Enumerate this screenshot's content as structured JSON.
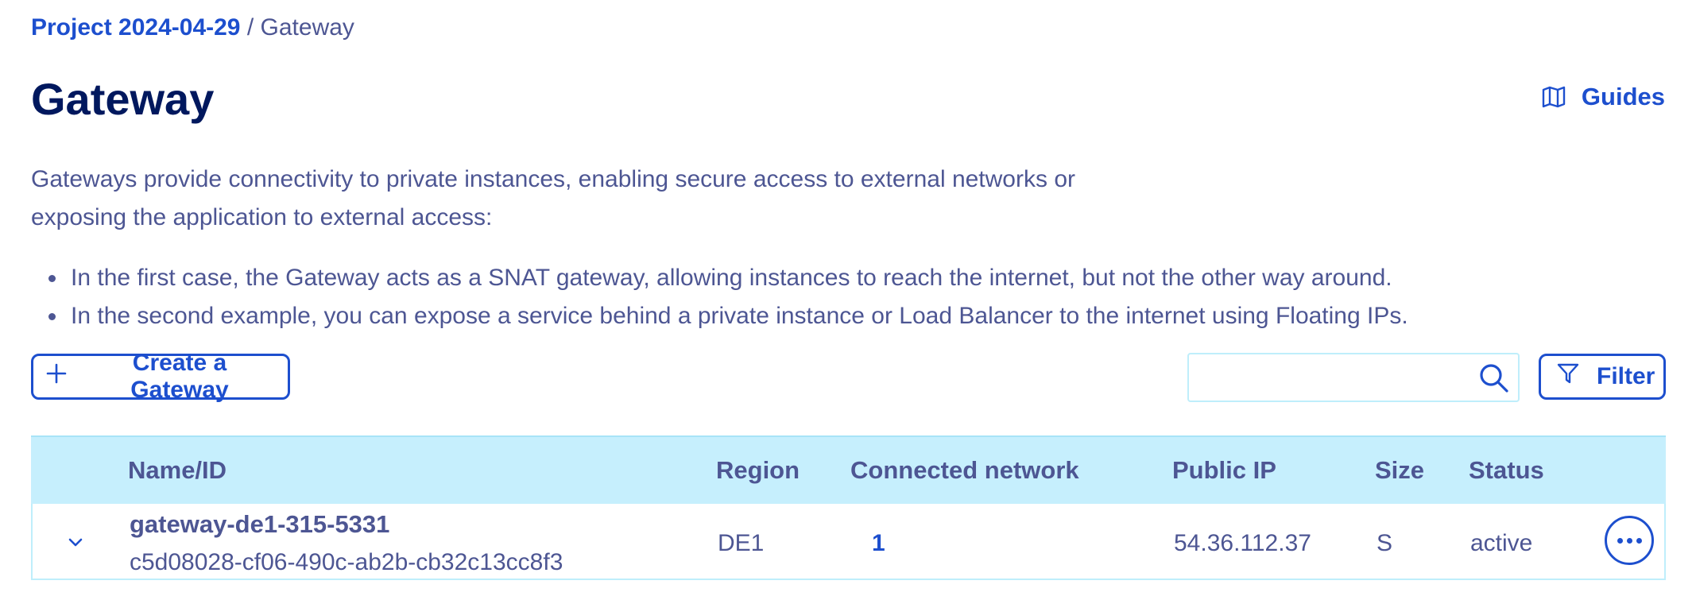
{
  "breadcrumb": {
    "project": "Project 2024-04-29",
    "separator": "/",
    "current": "Gateway"
  },
  "page": {
    "title": "Gateway",
    "guides_label": "Guides",
    "description": "Gateways provide connectivity to private instances, enabling secure access to external networks or exposing the application to external access:",
    "bullets": [
      "In the first case, the Gateway acts as a SNAT gateway, allowing instances to reach the internet, but not the other way around.",
      "In the second example, you can expose a service behind a private instance or Load Balancer to the internet using Floating IPs."
    ]
  },
  "toolbar": {
    "create_label": "Create a Gateway",
    "search_value": "",
    "filter_label": "Filter"
  },
  "table": {
    "headers": {
      "name": "Name/ID",
      "region": "Region",
      "network": "Connected network",
      "public_ip": "Public IP",
      "size": "Size",
      "status": "Status"
    },
    "rows": [
      {
        "name": "gateway-de1-315-5331",
        "id": "c5d08028-cf06-490c-ab2b-cb32c13cc8f3",
        "region": "DE1",
        "connected_network": "1",
        "public_ip": "54.36.112.37",
        "size": "S",
        "status": "active"
      }
    ]
  },
  "icons": {
    "guides": "book-open-icon",
    "create": "plus-icon",
    "search": "search-icon",
    "filter": "filter-funnel-icon",
    "expand": "chevron-down-icon",
    "actions": "more-horizontal-icon"
  },
  "colors": {
    "primary": "#1d4fce",
    "text": "#4d5693",
    "title": "#00185e",
    "table_header_bg": "#c6effd",
    "border_light": "#bfeefb"
  }
}
